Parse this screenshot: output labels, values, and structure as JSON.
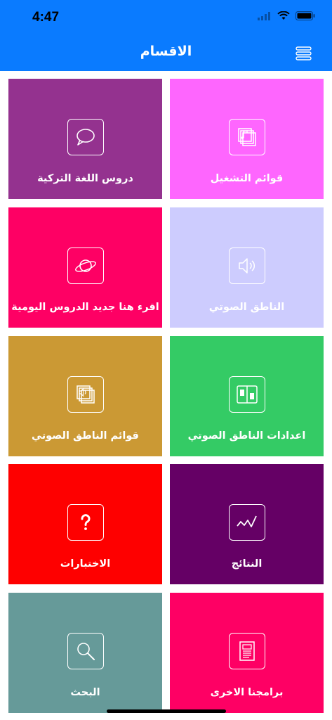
{
  "status_bar": {
    "time": "4:47"
  },
  "header": {
    "title": "الاقسام",
    "menu_icon": "hamburger-icon"
  },
  "tiles": [
    {
      "label": "دروس اللغة التركية",
      "color": "#94328f",
      "icon": "chat-bubble-icon"
    },
    {
      "label": "قوائم التشغيل",
      "color": "#fe66fe",
      "icon": "music-playlist-icon"
    },
    {
      "label": "اقرء هنا جديد الدروس اليومية",
      "color": "#fe0064",
      "icon": "planet-icon"
    },
    {
      "label": "الناطق الصوتي",
      "color": "#cdccfe",
      "icon": "speaker-icon"
    },
    {
      "label": "قوائم الناطق الصوتي",
      "color": "#cb9934",
      "icon": "audio-playlist-icon"
    },
    {
      "label": "اعدادات الناطق الصوتي",
      "color": "#34cb65",
      "icon": "settings-panel-icon"
    },
    {
      "label": "الاختبارات",
      "color": "#fe0000",
      "icon": "question-mark-icon"
    },
    {
      "label": "النتائج",
      "color": "#650065",
      "icon": "chart-line-icon"
    },
    {
      "label": "البحث",
      "color": "#669a99",
      "icon": "search-icon"
    },
    {
      "label": "برامجنا الاخرى",
      "color": "#fe0064",
      "icon": "document-icon"
    }
  ]
}
